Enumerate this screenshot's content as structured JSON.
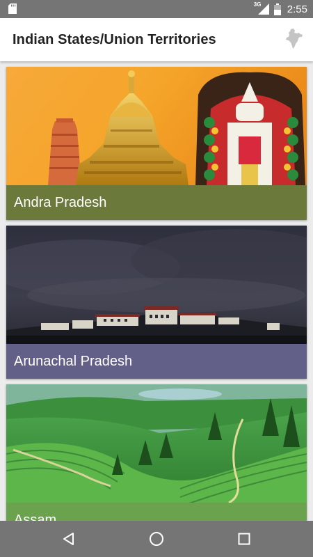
{
  "status_bar": {
    "time": "2:55",
    "network_type": "3G",
    "icons": [
      "sd-card-icon",
      "signal-icon",
      "battery-icon"
    ]
  },
  "app_bar": {
    "title": "Indian States/Union Territories",
    "icon": "india-map-icon"
  },
  "states": [
    {
      "name": "Andra Pradesh",
      "label_color": "#6b7a3a",
      "image": "temple-and-deity-image"
    },
    {
      "name": "Arunachal Pradesh",
      "label_color": "#626088",
      "image": "monastery-under-storm-clouds-image"
    },
    {
      "name": "Assam",
      "label_color": "#6aa24e",
      "image": "tea-garden-hills-image"
    }
  ],
  "nav_bar": {
    "icons": [
      "back-icon",
      "home-icon",
      "recents-icon"
    ]
  },
  "colors": {
    "status_bar": "#757575",
    "nav_bar": "#757575",
    "app_bar": "#ffffff",
    "list_background": "#ececec"
  }
}
